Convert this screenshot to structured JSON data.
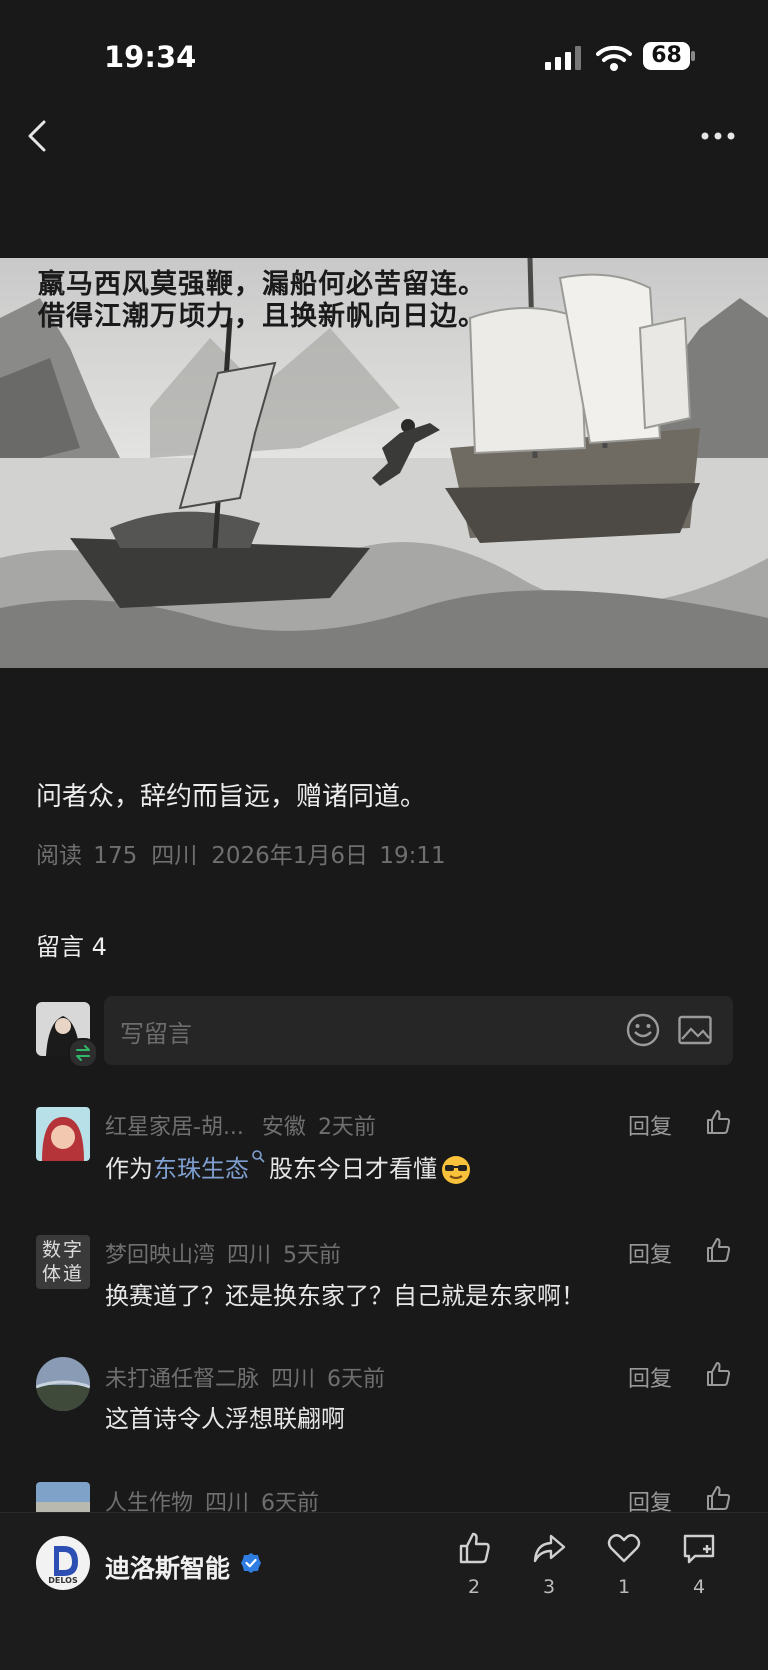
{
  "status_bar": {
    "time": "19:34",
    "battery": "68"
  },
  "poem": {
    "line1": "羸马西风莫强鞭，漏船何必苦留连。",
    "line2": "借得江潮万顷力，且换新帆向日边。"
  },
  "article": {
    "text": "问者众，辞约而旨远，赠诸同道。",
    "meta": {
      "reads": "阅读 175",
      "location": "四川",
      "date": "2026年1月6日 19:11"
    }
  },
  "comments": {
    "title": "留言 4",
    "input_placeholder": "写留言",
    "reply_label": "回复",
    "items": [
      {
        "name": "红星家居-胡...",
        "location": "安徽",
        "time": "2天前",
        "text_before": "作为",
        "link": "东珠生态",
        "text_after": "股东今日才看懂"
      },
      {
        "name": "梦回映山湾",
        "location": "四川",
        "time": "5天前",
        "text": "换赛道了？还是换东家了？自己就是东家啊！",
        "avatar_text": "数字体道"
      },
      {
        "name": "未打通任督二脉",
        "location": "四川",
        "time": "6天前",
        "text": "这首诗令人浮想联翩啊"
      },
      {
        "name": "人生作物",
        "location": "四川",
        "time": "6天前"
      }
    ]
  },
  "bottom_bar": {
    "author": "迪洛斯智能",
    "logo_text": "DELOS",
    "actions": {
      "like": "2",
      "share": "3",
      "favorite": "1",
      "comment": "4"
    }
  },
  "colors": {
    "background": "#191919",
    "link": "#7e9fd0",
    "verified": "#2f7de1"
  }
}
